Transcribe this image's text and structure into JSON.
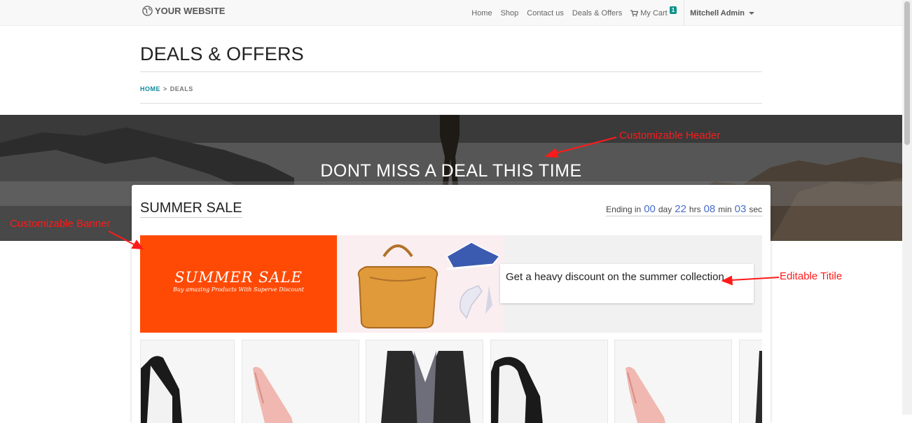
{
  "navbar": {
    "logo": "YOUR WEBSITE",
    "links": [
      "Home",
      "Shop",
      "Contact us",
      "Deals & Offers"
    ],
    "cart_label": "My Cart",
    "cart_count": "1",
    "user": "Mitchell Admin"
  },
  "page": {
    "title": "DEALS & OFFERS",
    "breadcrumb": {
      "home": "HOME",
      "sep": ">",
      "current": "DEALS"
    }
  },
  "hero": {
    "title": "DONT MISS A DEAL THIS TIME"
  },
  "deal": {
    "title": "SUMMER SALE",
    "countdown": {
      "prefix": "Ending in",
      "days": "00",
      "days_label": "day",
      "hours": "22",
      "hours_label": "hrs",
      "minutes": "08",
      "minutes_label": "min",
      "seconds": "03",
      "seconds_label": "sec"
    },
    "banner": {
      "title": "SUMMER SALE",
      "subtitle": "Buy amazing Products With Superve Discount"
    },
    "description": "Get a heavy discount on the summer collection"
  },
  "annotations": {
    "header": "Customizable Header",
    "banner": "Customizable Banner",
    "title": "Editable Titile"
  },
  "colors": {
    "accent": "#0d8a9a",
    "countdown": "#4b6ec8",
    "banner": "#ff4a05",
    "annotation": "#ff1a1a"
  }
}
